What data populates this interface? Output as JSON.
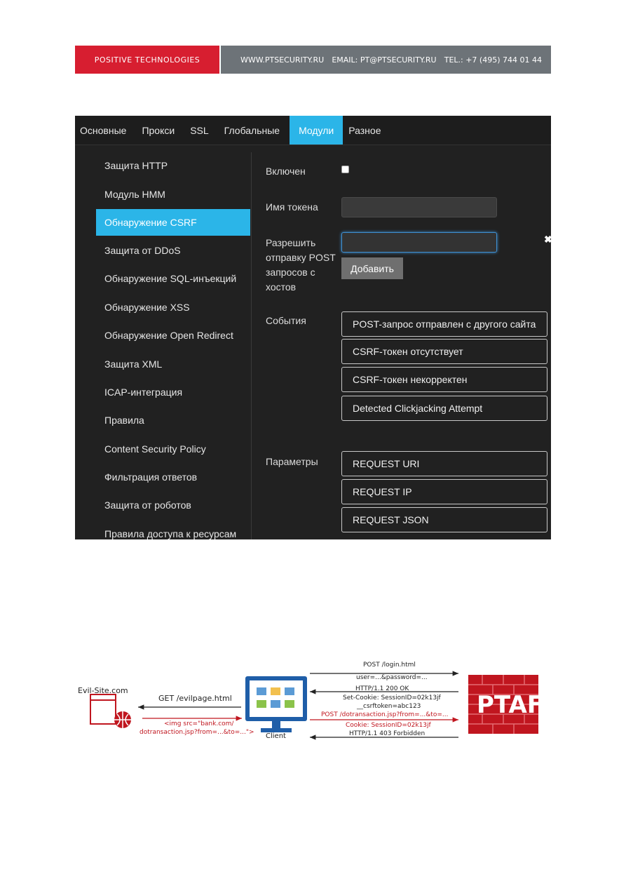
{
  "banner": {
    "brand": "POSITIVE TECHNOLOGIES",
    "website": "WWW.PTSECURITY.RU",
    "email": "EMAIL: PT@PTSECURITY.RU",
    "phone": "TEL.: +7 (495) 744 01 44"
  },
  "tabs": [
    "Основные",
    "Прокси",
    "SSL",
    "Глобальные",
    "Модули",
    "Разное"
  ],
  "active_tab": "Модули",
  "sidebar": [
    "Защита HTTP",
    "Модуль HMM",
    "Обнаружение CSRF",
    "Защита от DDoS",
    "Обнаружение SQL-инъекций",
    "Обнаружение XSS",
    "Обнаружение Open Redirect",
    "Защита XML",
    "ICAP-интеграция",
    "Правила",
    "Content Security Policy",
    "Фильтрация ответов",
    "Защита от роботов",
    "Правила доступа к ресурсам"
  ],
  "active_sidebar": "Обнаружение CSRF",
  "form": {
    "enabled_label": "Включен",
    "token_label": "Имя токена",
    "allow_label_1": "Разрешить",
    "allow_label_2": "отправку POST",
    "allow_label_3": "запросов с",
    "allow_label_4": "хостов",
    "add_button": "Добавить",
    "close_glyph": "✖",
    "events_label": "События",
    "params_label": "Параметры"
  },
  "events": [
    "POST-запрос отправлен с другого сайта",
    "CSRF-токен отсутствует",
    "CSRF-токен некорректен",
    "Detected Clickjacking Attempt"
  ],
  "params": [
    "REQUEST URI",
    "REQUEST IP",
    "REQUEST JSON"
  ],
  "diagram": {
    "evil_site": "Evil-Site.com",
    "get_request": "GET /evilpage.html",
    "img_tag_1": "<img src=\"bank.com/",
    "img_tag_2": "dotransaction.jsp?from=...&to=...\">",
    "client": "Client",
    "post_login": "POST /login.html",
    "user_pass": "user=...&password=...",
    "http_200": "HTTP/1.1 200 OK",
    "set_cookie": "Set-Cookie: SessionID=02k13jf",
    "csrf_token": "__csrftoken=abc123",
    "post_transaction": "POST /dotransaction.jsp?from=...&to=...",
    "cookie": "Cookie: SessionID=02k13jf",
    "http_403": "HTTP/1.1 403 Forbidden",
    "ptaf": "PTAF",
    "colors": {
      "red": "#c0161f",
      "brand_red": "#d71e30",
      "accent_blue": "#2bb5e8"
    }
  }
}
